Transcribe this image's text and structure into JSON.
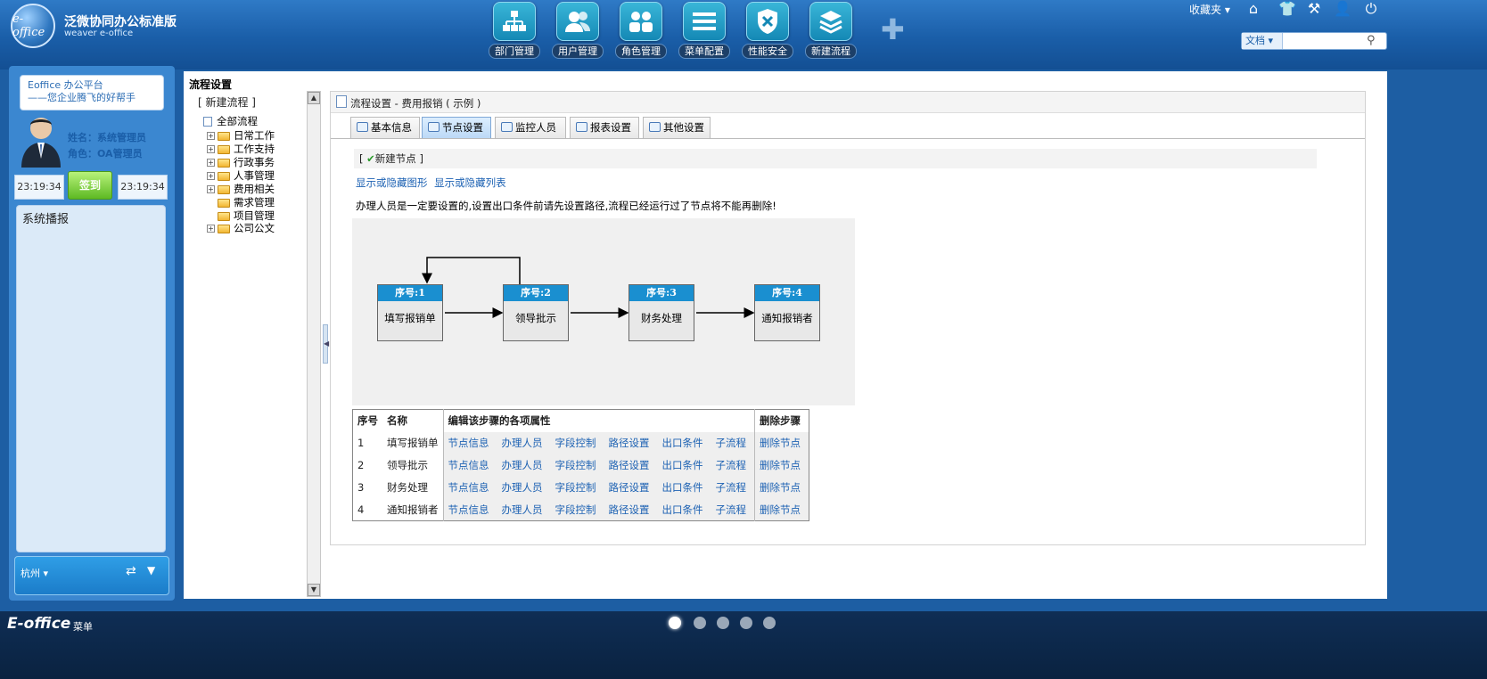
{
  "brand": {
    "logo_text": "e-office",
    "title": "泛微协同办公标准版",
    "subtitle": "weaver e-office"
  },
  "app_icons": [
    {
      "label": "部门管理",
      "icon": "org-chart-icon"
    },
    {
      "label": "用户管理",
      "icon": "users-icon"
    },
    {
      "label": "角色管理",
      "icon": "roles-icon"
    },
    {
      "label": "菜单配置",
      "icon": "menu-lines-icon"
    },
    {
      "label": "性能安全",
      "icon": "shield-icon"
    },
    {
      "label": "新建流程",
      "icon": "layers-icon"
    }
  ],
  "topbar": {
    "favorites_label": "收藏夹 ▾",
    "search_scope": "文档 ▾",
    "search_placeholder": ""
  },
  "left": {
    "bubble_line1": "Eoffice 办公平台",
    "bubble_line2": "——您企业腾飞的好帮手",
    "user_name": "姓名：系统管理员",
    "user_role": "角色：OA管理员",
    "time_left": "23:19:34",
    "sign_label": "签到",
    "time_right": "23:19:34",
    "notice_title": "系统播报",
    "weather_city": "杭州 ▾"
  },
  "main": {
    "title": "流程设置",
    "tree_new": "[ 新建流程 ]",
    "tree": [
      {
        "label": "全部流程",
        "expandable": false,
        "root": true
      },
      {
        "label": "日常工作",
        "expandable": true
      },
      {
        "label": "工作支持",
        "expandable": true
      },
      {
        "label": "行政事务",
        "expandable": true
      },
      {
        "label": "人事管理",
        "expandable": true
      },
      {
        "label": "费用相关",
        "expandable": true
      },
      {
        "label": "需求管理",
        "expandable": false
      },
      {
        "label": "项目管理",
        "expandable": false
      },
      {
        "label": "公司公文",
        "expandable": true
      }
    ],
    "panel_title": "流程设置 - 费用报销 ( 示例 )",
    "tabs": [
      {
        "label": "基本信息",
        "active": false
      },
      {
        "label": "节点设置",
        "active": true
      },
      {
        "label": "监控人员",
        "active": false
      },
      {
        "label": "报表设置",
        "active": false
      },
      {
        "label": "其他设置",
        "active": false
      }
    ],
    "new_node": "新建节点",
    "link_toggle_graph": "显示或隐藏图形",
    "link_toggle_list": "显示或隐藏列表",
    "note": "办理人员是一定要设置的,设置出口条件前请先设置路径,流程已经运行过了节点将不能再删除!",
    "nodes": [
      {
        "header": "序号:1",
        "name": "填写报销单"
      },
      {
        "header": "序号:2",
        "name": "领导批示"
      },
      {
        "header": "序号:3",
        "name": "财务处理"
      },
      {
        "header": "序号:4",
        "name": "通知报销者"
      }
    ],
    "table": {
      "headers": {
        "seq": "序号",
        "name": "名称",
        "props": "编辑该步骤的各项属性",
        "del": "删除步骤"
      },
      "actions": [
        "节点信息",
        "办理人员",
        "字段控制",
        "路径设置",
        "出口条件",
        "子流程"
      ],
      "delete_label": "删除节点",
      "rows": [
        {
          "seq": "1",
          "name": "填写报销单"
        },
        {
          "seq": "2",
          "name": "领导批示"
        },
        {
          "seq": "3",
          "name": "财务处理"
        },
        {
          "seq": "4",
          "name": "通知报销者"
        }
      ]
    }
  },
  "bottom": {
    "logo": "E-office",
    "menu_label": "菜单"
  }
}
